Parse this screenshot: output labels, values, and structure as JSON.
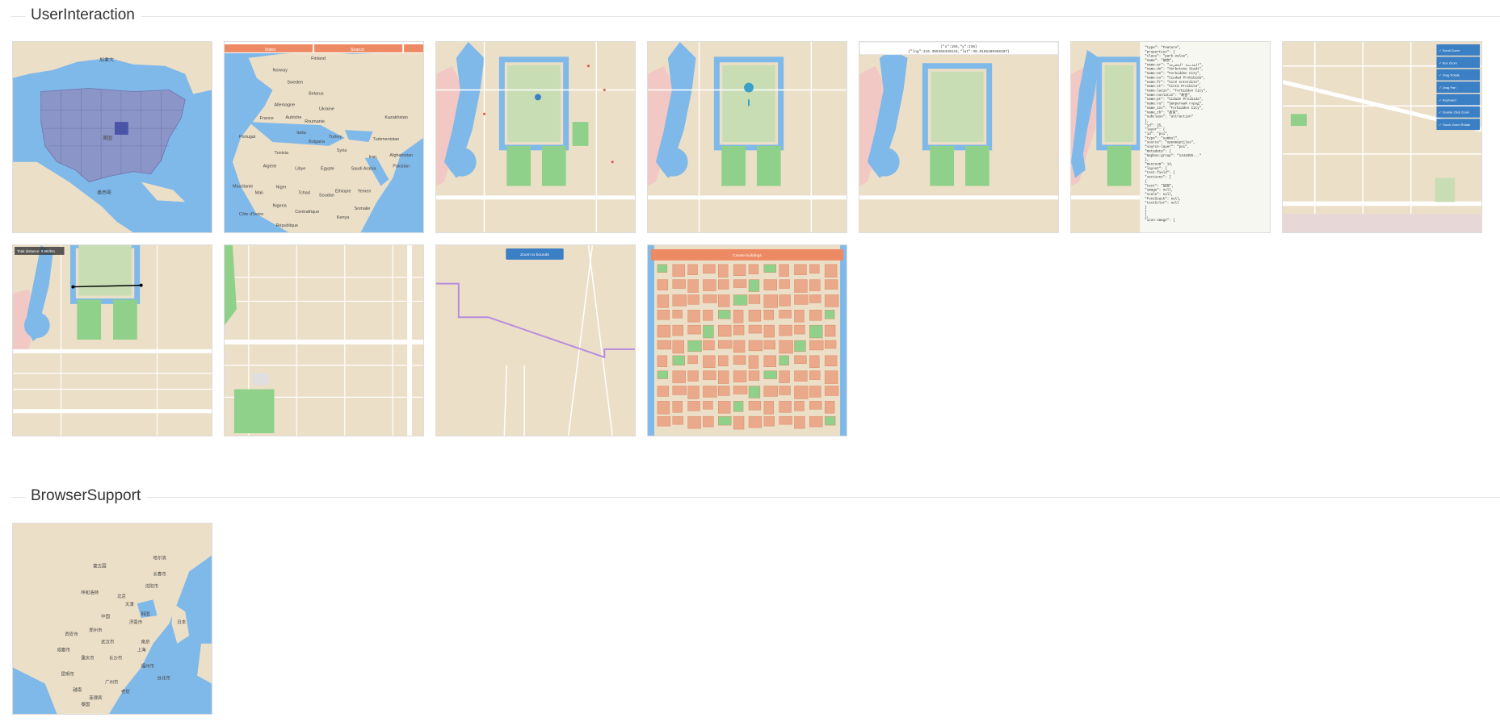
{
  "sections": [
    {
      "title": "UserInteraction"
    },
    {
      "title": "BrowserSupport"
    }
  ],
  "thumbs": {
    "t1": {
      "labels": [
        "加拿大",
        "墨西哥",
        "美国"
      ]
    },
    "t2": {
      "buttons": [
        "Video",
        "Search"
      ],
      "labels": [
        "Norway",
        "Finland",
        "Sweden",
        "Belarus",
        "Allemagne",
        "Ukraine",
        "France",
        "Autriche",
        "Roumanie",
        "Kazakhstan",
        "Portugal",
        "Italia",
        "Bulgaria",
        "Turkey",
        "Turkmenistan",
        "Tunisia",
        "Syria",
        "Iran",
        "Afghanistan",
        "Algérie",
        "Libye",
        "Égypte",
        "Saudi Arabia",
        "Pakistan",
        "Mauritanie",
        "Mali",
        "Niger",
        "Tchad",
        "Soudan",
        "Éthiopie",
        "Yemen",
        "Nigeria",
        "Centrafrique",
        "Somalie",
        "Kenya",
        "Côte d'Ivoire",
        "République"
      ]
    },
    "t5": {
      "header_line1": "{\"x\":155,\"y\":236}",
      "header_line2": "{\"lng\":116.395360430144,\"lat\":39.9165389356207}"
    },
    "t6": {
      "json_lines": [
        "\"type\": \"Feature\",",
        "\"properties\": {",
        "  \"class\": \"park-value\",",
        "  \"name\": \"故宫\",",
        "  \"name:ar\": \"المدينة المحرمة\",",
        "  \"name:de\": \"Verbotene Stadt\",",
        "  \"name:en\": \"Forbidden City\",",
        "  \"name:es\": \"Ciudad Prohibida\",",
        "  \"name:fr\": \"Cité Interdite\",",
        "  \"name:it\": \"Città Proibita\",",
        "  \"name:latin\": \"Forbidden City\",",
        "  \"name:nonlatin\": \"故宫\",",
        "  \"name:pt\": \"Cidade Proibida\",",
        "  \"name:ru\": \"Запретный город\",",
        "  \"name_int\": \"Forbidden City\",",
        "  \"name_zh\": \"故宫\",",
        "  \"subclass\": \"attraction\"",
        "},",
        "\"id\": 25,",
        "\"layer\": {",
        "  \"id\": \"poi\",",
        "  \"type\": \"symbol\",",
        "  \"source\": \"openmaptiles\",",
        "  \"source-layer\": \"poi\",",
        "  \"metadata\": {",
        "    \"mapbox:group\": \"1444855...\"",
        "  },",
        "  \"minzoom\": 14,",
        "  \"layout\": {",
        "    \"text-field\": {",
        "      \"sections\": [",
        "        {",
        "          \"text\": \"故宫\",",
        "          \"image\": null,",
        "          \"scale\": null,",
        "          \"fontStack\": null,",
        "          \"textColor\": null",
        "        }",
        "      ]",
        "    },",
        "    \"icon-image\": {"
      ]
    },
    "t7": {
      "toggles": [
        "✓ Scroll Zoom",
        "✓ Box Zoom",
        "✓ Drag Rotate",
        "✓ Drag Pan",
        "✓ Keyboard",
        "✓ Double Click Zoom",
        "✓ Touch Zoom Rotate"
      ]
    },
    "t8": {
      "overlay": "Total distance: 0.962km"
    },
    "t10": {
      "button": "Zoom to bounds"
    },
    "t11": {
      "banner": "Create buildings"
    },
    "t12": {
      "labels": [
        "蒙古国",
        "哈尔滨",
        "长春市",
        "沈阳市",
        "呼和浩特",
        "北京",
        "天津",
        "韩国",
        "日本",
        "中国",
        "济南市",
        "郑州市",
        "西安市",
        "成都市",
        "武汉市",
        "南京",
        "上海",
        "重庆市",
        "长沙市",
        "福州市",
        "昆明市",
        "广州市",
        "越南",
        "老挝",
        "菲律宾",
        "泰国",
        "台北市"
      ]
    }
  },
  "colors": {
    "land": "#ecdfc7",
    "water": "#7fb9ea",
    "park": "#8fd18a",
    "road": "#ffffff",
    "accent_orange": "#ee8a63",
    "us_fill": "#8c95c7",
    "us_highlight": "#4a55a8",
    "route": "#b68ce0",
    "button_blue": "#3b7fc4"
  }
}
